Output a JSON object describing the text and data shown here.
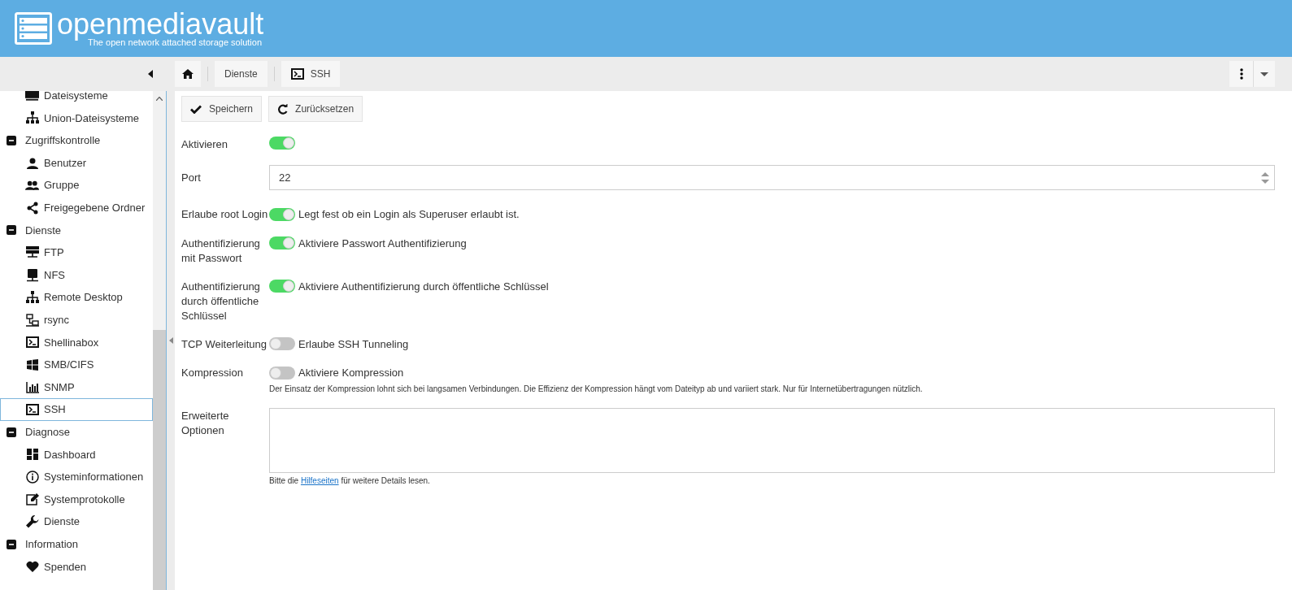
{
  "header": {
    "title": "openmediavault",
    "subtitle": "The open network attached storage solution"
  },
  "breadcrumb": [
    {
      "label": "Dienste"
    },
    {
      "label": "SSH"
    }
  ],
  "sidebar": {
    "items": [
      {
        "children": [
          {
            "label": "Dateisysteme",
            "selected": false
          },
          {
            "label": "Union-Dateisysteme",
            "selected": false
          }
        ]
      },
      {
        "label": "Zugriffskontrolle",
        "expanded": true,
        "children": [
          {
            "label": "Benutzer",
            "selected": false
          },
          {
            "label": "Gruppe",
            "selected": false
          },
          {
            "label": "Freigegebene Ordner",
            "selected": false
          }
        ]
      },
      {
        "label": "Dienste",
        "expanded": true,
        "children": [
          {
            "label": "FTP",
            "selected": false
          },
          {
            "label": "NFS",
            "selected": false
          },
          {
            "label": "Remote Desktop",
            "selected": false
          },
          {
            "label": "rsync",
            "selected": false
          },
          {
            "label": "Shellinabox",
            "selected": false
          },
          {
            "label": "SMB/CIFS",
            "selected": false
          },
          {
            "label": "SNMP",
            "selected": false
          },
          {
            "label": "SSH",
            "selected": true
          }
        ]
      },
      {
        "label": "Diagnose",
        "expanded": true,
        "children": [
          {
            "label": "Dashboard",
            "selected": false
          },
          {
            "label": "Systeminformationen",
            "selected": false
          },
          {
            "label": "Systemprotokolle",
            "selected": false
          },
          {
            "label": "Dienste",
            "selected": false
          }
        ]
      },
      {
        "label": "Information",
        "expanded": true,
        "children": [
          {
            "label": "Spenden",
            "selected": false
          }
        ]
      }
    ]
  },
  "actions": [
    "Speichern",
    "Zurücksetzen"
  ],
  "form": [
    {
      "kind": "toggle",
      "label": "Aktivieren",
      "on": true
    },
    {
      "kind": "number",
      "label": "Port",
      "value": "22"
    },
    {
      "kind": "toggle",
      "label": "Erlaube root Login",
      "on": true,
      "description": "Legt fest ob ein Login als Superuser erlaubt ist."
    },
    {
      "kind": "toggle",
      "label": "Authentifizierung mit Passwort",
      "on": true,
      "description": "Aktiviere Passwort Authentifizierung"
    },
    {
      "kind": "toggle",
      "label": "Authentifizierung durch öffentliche Schlüssel",
      "on": true,
      "description": "Aktiviere Authentifizierung durch öffentliche Schlüssel"
    },
    {
      "kind": "toggle",
      "label": "TCP Weiterleitung",
      "on": false,
      "description": "Erlaube SSH Tunneling"
    },
    {
      "kind": "toggle",
      "label": "Kompression",
      "on": false,
      "description": "Aktiviere Kompression",
      "hint": "Der Einsatz der Kompression lohnt sich bei langsamen Verbindungen. Die Effizienz der Kompression hängt vom Dateityp ab und variiert stark. Nur für Internetübertragungen nützlich."
    },
    {
      "kind": "textarea",
      "label": "Erweiterte Optionen",
      "hint": "Bitte die ",
      "hint_link": "Hilfeseiten",
      "hint_after": " für weitere Details lesen."
    }
  ]
}
